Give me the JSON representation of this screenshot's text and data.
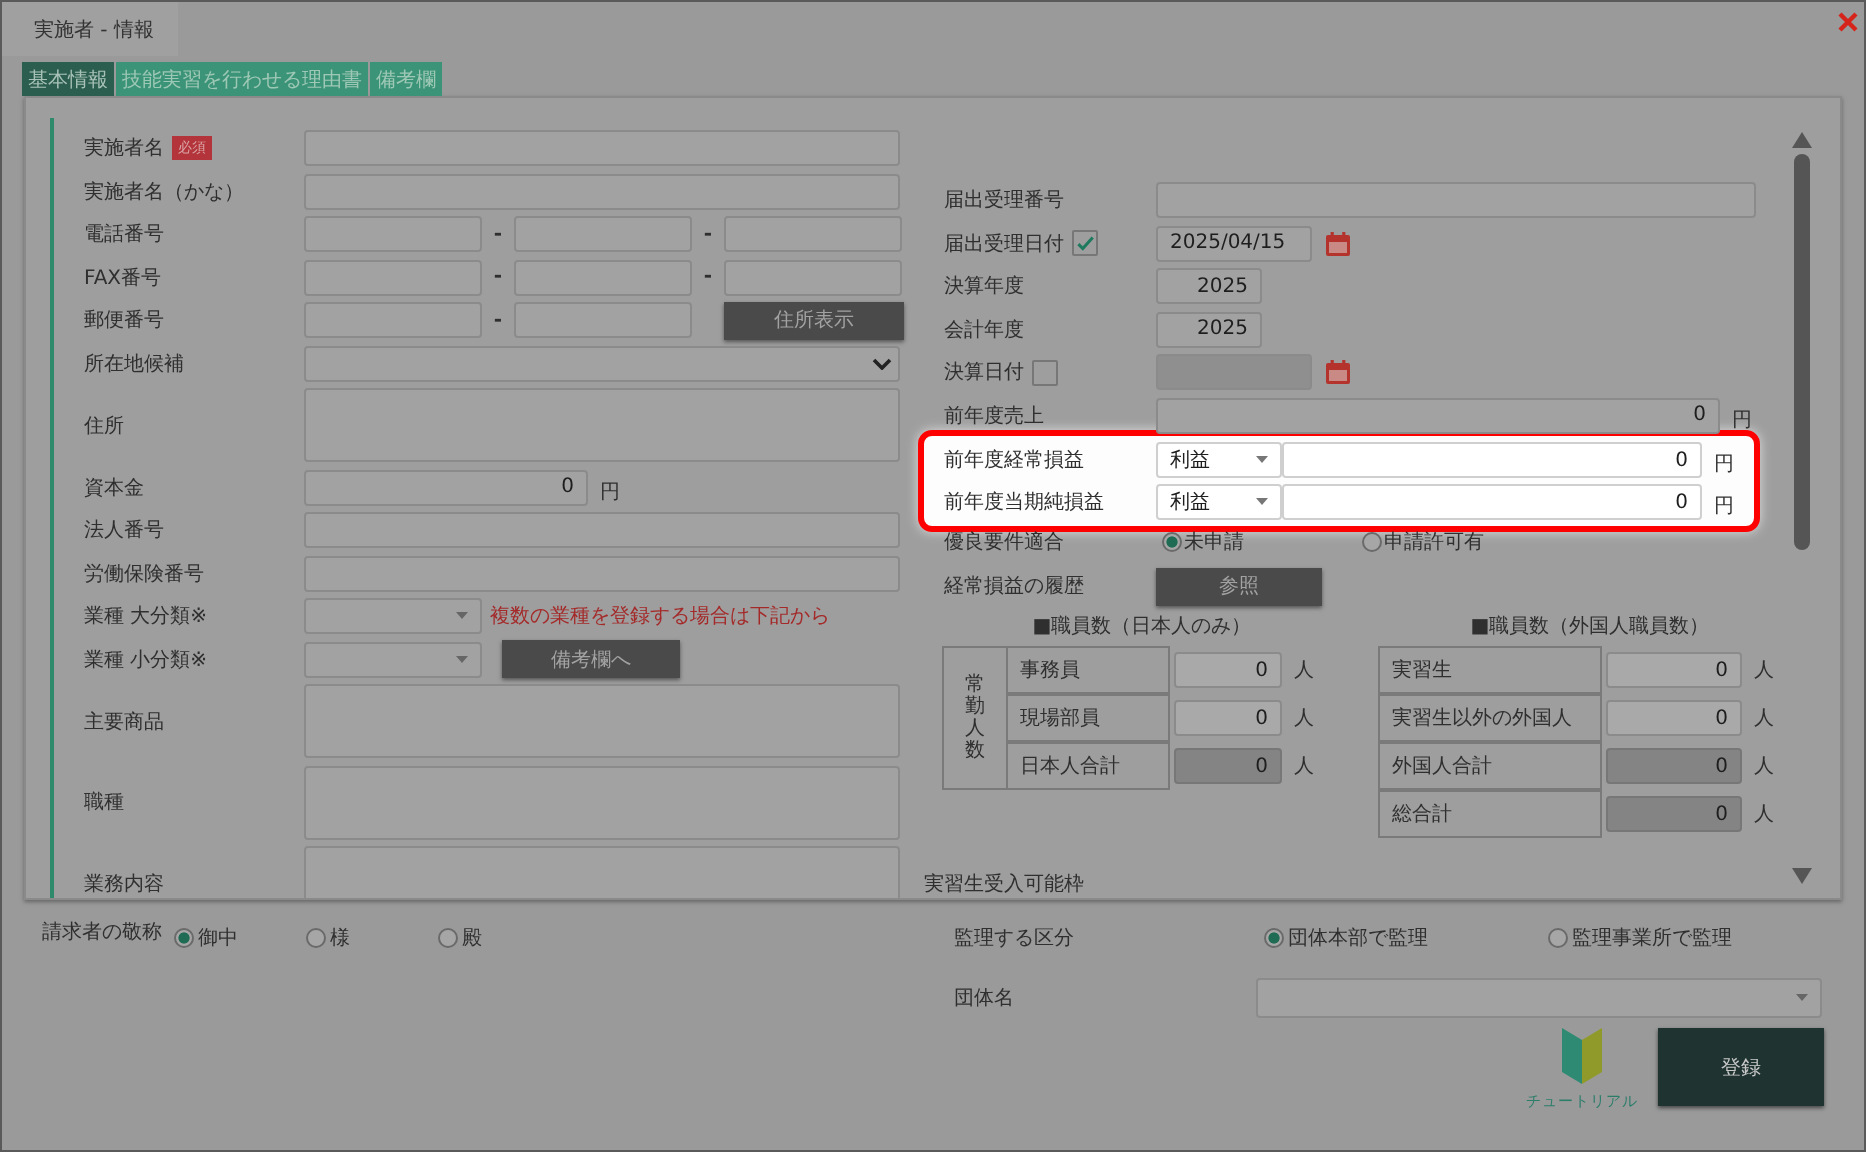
{
  "window": {
    "title": "実施者 - 情報"
  },
  "tabs": [
    {
      "label": "基本情報",
      "selected": true
    },
    {
      "label": "技能実習を行わせる理由書",
      "selected": false
    },
    {
      "label": "備考欄",
      "selected": false
    }
  ],
  "left_fields": [
    {
      "kind": "text",
      "label": "実施者名",
      "badge": "必須"
    },
    {
      "kind": "text",
      "label": "実施者名（かな）"
    },
    {
      "kind": "phone",
      "label": "電話番号",
      "separators": [
        "-",
        "-"
      ]
    },
    {
      "kind": "phone",
      "label": "FAX番号",
      "separators": [
        "-",
        "-"
      ]
    },
    {
      "kind": "postal",
      "label": "郵便番号",
      "separators": [
        "-"
      ],
      "button": "住所表示"
    },
    {
      "kind": "select",
      "label": "所在地候補"
    },
    {
      "kind": "textarea",
      "label": "住所"
    },
    {
      "kind": "amount",
      "label": "資本金",
      "value": "0",
      "unit": "円"
    },
    {
      "kind": "text",
      "label": "法人番号"
    },
    {
      "kind": "text",
      "label": "労働保険番号"
    },
    {
      "kind": "small_select",
      "label": "業種 大分類※",
      "note": "複数の業種を登録する場合は下記から"
    },
    {
      "kind": "small_select",
      "label": "業種 小分類※",
      "button": "備考欄へ"
    },
    {
      "kind": "textarea",
      "label": "主要商品"
    },
    {
      "kind": "textarea",
      "label": "職種"
    },
    {
      "kind": "textarea",
      "label": "業務内容"
    }
  ],
  "right_fields": [
    {
      "kind": "text",
      "label": "届出受理番号",
      "highlighted": false
    },
    {
      "kind": "date",
      "label": "届出受理日付",
      "checked": true,
      "value": "2025/04/15",
      "highlighted": false
    },
    {
      "kind": "year",
      "label": "決算年度",
      "value": "2025",
      "highlighted": false
    },
    {
      "kind": "year",
      "label": "会計年度",
      "value": "2025",
      "highlighted": false
    },
    {
      "kind": "date",
      "label": "決算日付",
      "checked": false,
      "highlighted": false
    },
    {
      "kind": "amount",
      "label": "前年度売上",
      "value": "0",
      "unit": "円",
      "highlighted": false
    },
    {
      "kind": "profit",
      "label": "前年度経常損益",
      "select": "利益",
      "value": "0",
      "unit": "円",
      "highlighted": true
    },
    {
      "kind": "profit",
      "label": "前年度当期純損益",
      "select": "利益",
      "value": "0",
      "unit": "円",
      "highlighted": true
    },
    {
      "kind": "radio",
      "label": "優良要件適合",
      "options": [
        {
          "label": "未申請",
          "selected": true
        },
        {
          "label": "申請許可有",
          "selected": false
        }
      ],
      "highlighted": false
    },
    {
      "kind": "button",
      "label": "経常損益の履歴",
      "button": "参照",
      "highlighted": false
    }
  ],
  "staff_tables": [
    {
      "heading": "■職員数（日本人のみ）",
      "group": "常勤人数",
      "rows": [
        {
          "label": "事務員",
          "value": "0",
          "unit": "人",
          "readonly": false
        },
        {
          "label": "現場部員",
          "value": "0",
          "unit": "人",
          "readonly": false
        },
        {
          "label": "日本人合計",
          "value": "0",
          "unit": "人",
          "readonly": true
        }
      ]
    },
    {
      "heading": "■職員数（外国人職員数）",
      "rows": [
        {
          "label": "実習生",
          "value": "0",
          "unit": "人",
          "readonly": false
        },
        {
          "label": "実習生以外の外国人",
          "value": "0",
          "unit": "人",
          "readonly": false
        },
        {
          "label": "外国人合計",
          "value": "0",
          "unit": "人",
          "readonly": true
        },
        {
          "label": "総合計",
          "value": "0",
          "unit": "人",
          "readonly": true
        }
      ]
    }
  ],
  "trailing_label": "実習生受入可能枠",
  "honorific": {
    "label": "請求者の敬称",
    "options": [
      {
        "label": "御中",
        "selected": true
      },
      {
        "label": "様",
        "selected": false
      },
      {
        "label": "殿",
        "selected": false
      }
    ]
  },
  "supervision": {
    "label": "監理する区分",
    "options": [
      {
        "label": "団体本部で監理",
        "selected": true
      },
      {
        "label": "監理事業所で監理",
        "selected": false
      }
    ]
  },
  "organization": {
    "label": "団体名"
  },
  "tutorial": "チュートリアル",
  "submit": "登録"
}
